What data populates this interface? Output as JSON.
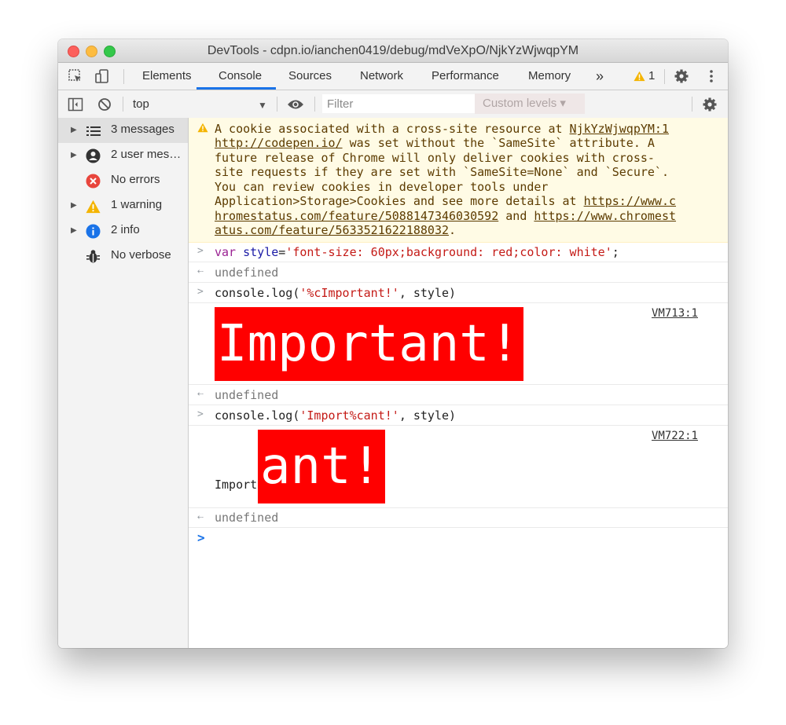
{
  "window": {
    "title": "DevTools - cdpn.io/ianchen0419/debug/mdVeXpO/NjkYzWjwqpYM"
  },
  "tabs": {
    "items": [
      "Elements",
      "Console",
      "Sources",
      "Network",
      "Performance",
      "Memory"
    ],
    "more": "»",
    "warning_count": "1",
    "active": "Console"
  },
  "filterbar": {
    "context": "top",
    "filter_placeholder": "Filter",
    "levels": "Custom levels ▾"
  },
  "sidebar": {
    "items": [
      {
        "label": "3 messages",
        "icon": "list-icon",
        "has_arrow": true,
        "selected": true
      },
      {
        "label": "2 user mes…",
        "icon": "user-icon",
        "has_arrow": true
      },
      {
        "label": "No errors",
        "icon": "error-icon",
        "has_arrow": false
      },
      {
        "label": "1 warning",
        "icon": "warning-icon",
        "has_arrow": true
      },
      {
        "label": "2 info",
        "icon": "info-icon",
        "has_arrow": true
      },
      {
        "label": "No verbose",
        "icon": "bug-icon",
        "has_arrow": false
      }
    ]
  },
  "console": {
    "warning": {
      "l1": "A cookie associated with a cross-site resource at ",
      "l1_link": "NjkYzWjwqpYM:1",
      "l2_link": "http://codepen.io/",
      "l2": " was set without the `SameSite` attribute. A",
      "l3": "future release of Chrome will only deliver cookies with cross-",
      "l4": "site requests if they are set with `SameSite=None` and `Secure`.",
      "l5": "You can review cookies in developer tools under",
      "l6a": "Application>Storage>Cookies and see more details at ",
      "l6_link": "https://www.c",
      "l7_link": "hromestatus.com/feature/5088147346030592",
      "l7b": " and ",
      "l7_link2": "https://www.chromest",
      "l8_link": "atus.com/feature/5633521622188032",
      "l8b": "."
    },
    "input1": {
      "kw": "var",
      "var": "style",
      "eq": "=",
      "str": "'font-size: 60px;background: red;color: white'",
      "semi": ";"
    },
    "result": "undefined",
    "input2": {
      "pre": "console.log(",
      "str": "'%cImportant!'",
      "post": ", style)"
    },
    "output1": {
      "text": "Important!",
      "source": "VM713:1"
    },
    "input3": {
      "pre": "console.log(",
      "str": "'Import%cant!'",
      "post": ", style)"
    },
    "output2": {
      "plain": "Import",
      "styled": "ant!",
      "source": "VM722:1"
    },
    "styled_bg": "#ff0000"
  }
}
